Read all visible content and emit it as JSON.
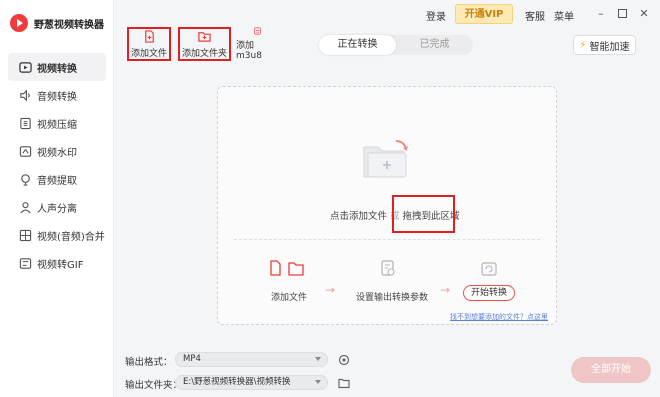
{
  "app": {
    "title": "野葱视频转换器"
  },
  "topbar": {
    "login": "登录",
    "vip": "开通VIP",
    "service": "客服",
    "menu": "菜单"
  },
  "sidebar": {
    "items": [
      {
        "label": "视频转换",
        "icon": "video-convert-icon",
        "active": true
      },
      {
        "label": "音频转换",
        "icon": "audio-icon"
      },
      {
        "label": "视频压缩",
        "icon": "compress-icon"
      },
      {
        "label": "视频水印",
        "icon": "watermark-icon"
      },
      {
        "label": "音频提取",
        "icon": "extract-icon"
      },
      {
        "label": "人声分离",
        "icon": "person-icon"
      },
      {
        "label": "视频(音频)合并",
        "icon": "merge-icon"
      },
      {
        "label": "视频转GIF",
        "icon": "gif-icon"
      }
    ]
  },
  "toolbar": {
    "add_file": "添加文件",
    "add_folder": "添加文件夹",
    "add_m3u8": "添加m3u8"
  },
  "tabs": {
    "converting": "正在转换",
    "done": "已完成"
  },
  "smart_speed": "智能加速",
  "dropzone": {
    "prompt": "点击添加文件",
    "or": "或",
    "drag": "拖拽到此区域"
  },
  "steps": {
    "step1": "添加文件",
    "step2": "设置输出转换参数",
    "step3": "开始转换"
  },
  "help_link": "找不到想要添加的文件？点这里",
  "output": {
    "format_label": "输出格式：",
    "format_value": "MP4",
    "folder_label": "输出文件夹：",
    "folder_value": "E:\\野葱视频转换器\\视频转换"
  },
  "start_all": "全部开始",
  "colors": {
    "accent": "#ef3b3b",
    "highlight": "#e02020"
  }
}
